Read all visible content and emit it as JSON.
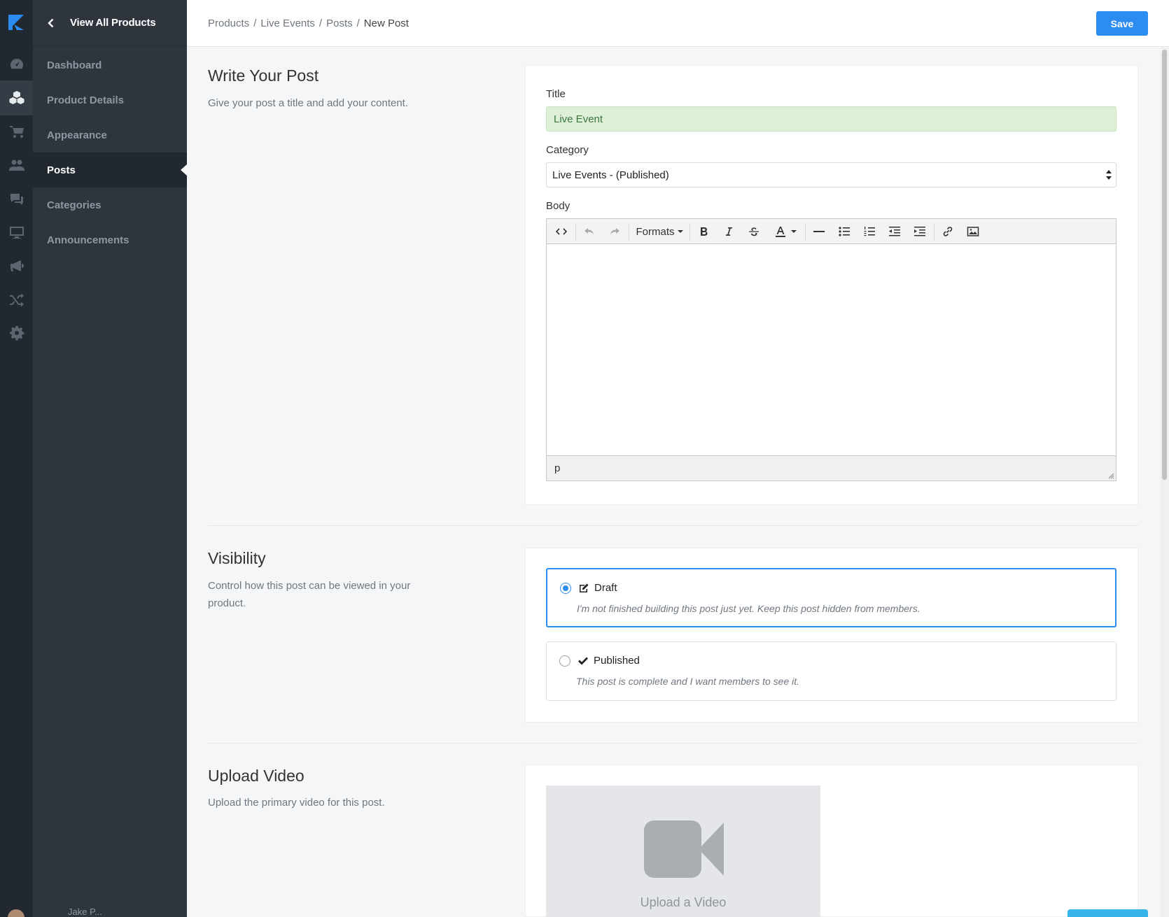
{
  "rail": {
    "icons": [
      "dashboard-icon",
      "products-icon",
      "cart-icon",
      "members-icon",
      "chat-icon",
      "monitor-icon",
      "megaphone-icon",
      "shuffle-icon",
      "settings-icon"
    ]
  },
  "sidebar": {
    "back_label": "View All Products",
    "items": [
      {
        "label": "Dashboard"
      },
      {
        "label": "Product Details"
      },
      {
        "label": "Appearance"
      },
      {
        "label": "Posts"
      },
      {
        "label": "Categories"
      },
      {
        "label": "Announcements"
      }
    ],
    "active": "Posts",
    "user_name": "Jake P..."
  },
  "header": {
    "breadcrumbs": [
      "Products",
      "Live Events",
      "Posts",
      "New Post"
    ],
    "save_label": "Save"
  },
  "write": {
    "title": "Write Your Post",
    "description": "Give your post a title and add your content.",
    "title_label": "Title",
    "title_value": "Live Event",
    "category_label": "Category",
    "category_value": "Live Events - (Published)",
    "body_label": "Body",
    "formats_label": "Formats",
    "path_label": "p"
  },
  "visibility": {
    "title": "Visibility",
    "description": "Control how this post can be viewed in your product.",
    "options": [
      {
        "label": "Draft",
        "description": "I'm not finished building this post just yet. Keep this post hidden from members.",
        "selected": true
      },
      {
        "label": "Published",
        "description": "This post is complete and I want members to see it.",
        "selected": false
      }
    ]
  },
  "video": {
    "title": "Upload Video",
    "description": "Upload the primary video for this post.",
    "upload_label": "Upload a Video"
  },
  "colors": {
    "accent": "#2d8cf0",
    "sidebar_bg": "#2e353d",
    "rail_bg": "#22282f",
    "success_bg": "#dff0d8"
  }
}
